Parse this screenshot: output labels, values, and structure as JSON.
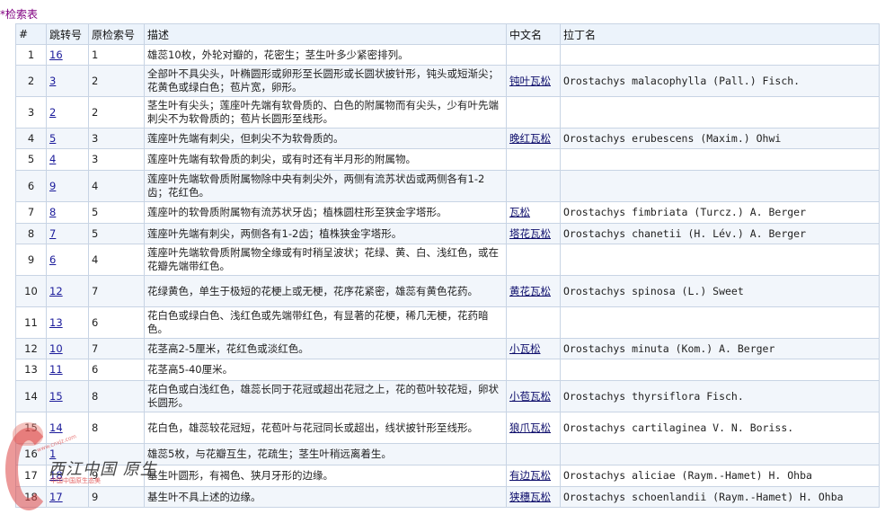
{
  "page": {
    "title_marker": "*",
    "title": "检索表"
  },
  "table": {
    "headers": [
      "#",
      "跳转号",
      "原检索号",
      "描述",
      "中文名",
      "拉丁名"
    ],
    "rows": [
      {
        "idx": "1",
        "jump": "16",
        "orig": "1",
        "desc": "雄蕊10枚，外轮对瓣的，花密生；茎生叶多少紧密排列。",
        "cn": "",
        "lat": ""
      },
      {
        "idx": "2",
        "jump": "3",
        "orig": "2",
        "desc": "全部叶不具尖头，叶椭圆形或卵形至长圆形或长圆状披针形，钝头或短渐尖；花黄色或绿白色；苞片宽，卵形。",
        "cn": "钝叶瓦松",
        "lat": "Orostachys malacophylla (Pall.) Fisch."
      },
      {
        "idx": "3",
        "jump": "2",
        "orig": "2",
        "desc": "茎生叶有尖头；莲座叶先端有软骨质的、白色的附属物而有尖头，少有叶先端刺尖不为软骨质的；苞片长圆形至线形。",
        "cn": "",
        "lat": ""
      },
      {
        "idx": "4",
        "jump": "5",
        "orig": "3",
        "desc": "莲座叶先端有刺尖，但刺尖不为软骨质的。",
        "cn": "晚红瓦松",
        "lat": "Orostachys erubescens (Maxim.) Ohwi"
      },
      {
        "idx": "5",
        "jump": "4",
        "orig": "3",
        "desc": "莲座叶先端有软骨质的刺尖，或有时还有半月形的附属物。",
        "cn": "",
        "lat": ""
      },
      {
        "idx": "6",
        "jump": "9",
        "orig": "4",
        "desc": "莲座叶先端软骨质附属物除中央有刺尖外，两侧有流苏状齿或两侧各有1-2齿；花红色。",
        "cn": "",
        "lat": ""
      },
      {
        "idx": "7",
        "jump": "8",
        "orig": "5",
        "desc": "莲座叶的软骨质附属物有流苏状牙齿；植株圆柱形至狭金字塔形。",
        "cn": "瓦松",
        "lat": "Orostachys fimbriata (Turcz.) A. Berger"
      },
      {
        "idx": "8",
        "jump": "7",
        "orig": "5",
        "desc": "莲座叶先端有刺尖，两侧各有1-2齿；植株狭金字塔形。",
        "cn": "塔花瓦松",
        "lat": "Orostachys chanetii (H. Lév.) A. Berger"
      },
      {
        "idx": "9",
        "jump": "6",
        "orig": "4",
        "desc": "莲座叶先端软骨质附属物全缘或有时稍呈波状；花绿、黄、白、浅红色，或在花瓣先端带红色。",
        "cn": "",
        "lat": ""
      },
      {
        "idx": "10",
        "jump": "12",
        "orig": "7",
        "desc": "花绿黄色，单生于极短的花梗上或无梗，花序花紧密，雄蕊有黄色花药。",
        "cn": "黄花瓦松",
        "lat": "Orostachys spinosa (L.) Sweet"
      },
      {
        "idx": "11",
        "jump": "13",
        "orig": "6",
        "desc": "花白色或绿白色、浅红色或先端带红色，有显著的花梗，稀几无梗，花药暗色。",
        "cn": "",
        "lat": ""
      },
      {
        "idx": "12",
        "jump": "10",
        "orig": "7",
        "desc": "花茎高2-5厘米，花红色或淡红色。",
        "cn": "小瓦松",
        "lat": "Orostachys minuta (Kom.) A. Berger"
      },
      {
        "idx": "13",
        "jump": "11",
        "orig": "6",
        "desc": "花茎高5-40厘米。",
        "cn": "",
        "lat": ""
      },
      {
        "idx": "14",
        "jump": "15",
        "orig": "8",
        "desc": "花白色或白浅红色，雄蕊长同于花冠或超出花冠之上，花的苞叶较花短，卵状长圆形。",
        "cn": "小苞瓦松",
        "lat": "Orostachys thyrsiflora Fisch."
      },
      {
        "idx": "15",
        "jump": "14",
        "orig": "8",
        "desc": "花白色，雄蕊较花冠短，花苞叶与花冠同长或超出，线状披针形至线形。",
        "cn": "狼爪瓦松",
        "lat": "Orostachys cartilaginea V. N. Boriss."
      },
      {
        "idx": "16",
        "jump": "1",
        "orig": "",
        "desc": "雄蕊5枚，与花瓣互生，花疏生；茎生叶稍远离着生。",
        "cn": "",
        "lat": ""
      },
      {
        "idx": "17",
        "jump": "18",
        "orig": "9",
        "desc": "基生叶圆形，有褐色、狭月牙形的边缘。",
        "cn": "有边瓦松",
        "lat": "Orostachys aliciae (Raym.-Hamet) H. Ohba"
      },
      {
        "idx": "18",
        "jump": "17",
        "orig": "9",
        "desc": "基生叶不具上述的边缘。",
        "cn": "狭穗瓦松",
        "lat": "Orostachys schoenlandii (Raym.-Hamet) H. Ohba"
      }
    ]
  },
  "watermark": {
    "main_text": "西江中国 原生",
    "sub_text": "中国中国原生态美",
    "url_text": "www.cnxjz.com"
  },
  "colors": {
    "title": "#800080",
    "link": "#1a1a9a",
    "header_bg": "#ecf3fb",
    "row_alt_bg": "#f2f6fb",
    "border": "#c8d4e4"
  }
}
